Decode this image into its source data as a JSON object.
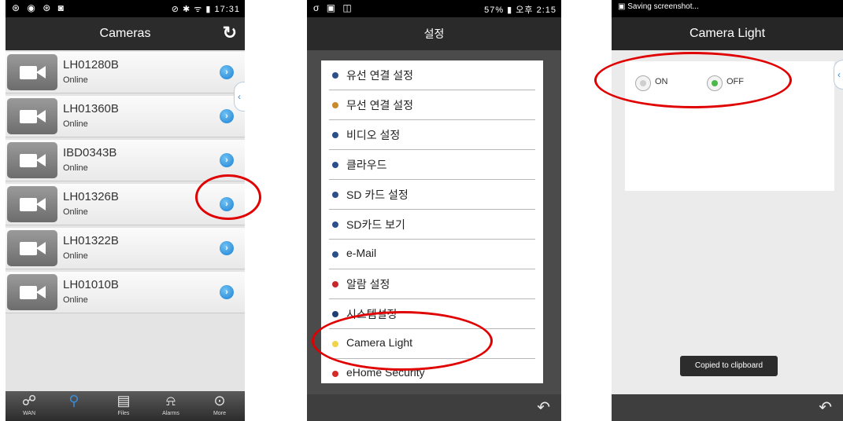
{
  "panel1": {
    "status_left": "⊛ ◉ ⊛ ◙",
    "status_icons": "⊘ ✱ ᯤ",
    "time": "17:31",
    "title": "Cameras",
    "refresh_glyph": "↻",
    "cameras": [
      {
        "name": "LH01280B",
        "status": "Online"
      },
      {
        "name": "LH01360B",
        "status": "Online"
      },
      {
        "name": "IBD0343B",
        "status": "Online"
      },
      {
        "name": "LH01326B",
        "status": "Online"
      },
      {
        "name": "LH01322B",
        "status": "Online"
      },
      {
        "name": "LH01010B",
        "status": "Online"
      }
    ],
    "tabs": [
      {
        "label": "WAN",
        "icon": "people-icon"
      },
      {
        "label": "",
        "icon": "search-icon"
      },
      {
        "label": "Files",
        "icon": "clipboard-icon"
      },
      {
        "label": "Alarms",
        "icon": "bell-icon"
      },
      {
        "label": "More",
        "icon": "more-icon"
      }
    ]
  },
  "panel2": {
    "status_left": "σ ▣ ◫",
    "status_right": "57% ▮ 오후 2:15",
    "title": "설정",
    "items": [
      {
        "label": "유선 연결 설정",
        "color": "#2c4f8a"
      },
      {
        "label": "무선 연결 설정",
        "color": "#c98a2a"
      },
      {
        "label": "비디오 설정",
        "color": "#2c4f8a"
      },
      {
        "label": "클라우드",
        "color": "#2c4f8a"
      },
      {
        "label": "SD 카드 설정",
        "color": "#2c4f8a"
      },
      {
        "label": "SD카드 보기",
        "color": "#2c4f8a"
      },
      {
        "label": "e-Mail",
        "color": "#2c4f8a"
      },
      {
        "label": "알람 설정",
        "color": "#c8262b"
      },
      {
        "label": "시스템설정",
        "color": "#1e3e74"
      },
      {
        "label": "Camera Light",
        "color": "#f0d34a"
      },
      {
        "label": "eHome Security",
        "color": "#d62b2b"
      }
    ]
  },
  "panel3": {
    "status_text": "Saving screenshot...",
    "title": "Camera Light",
    "on_label": "ON",
    "off_label": "OFF",
    "selected": "OFF",
    "toast": "Copied to clipboard"
  },
  "colors": {
    "annotation": "#e00000",
    "accent": "#1e7fd0"
  }
}
